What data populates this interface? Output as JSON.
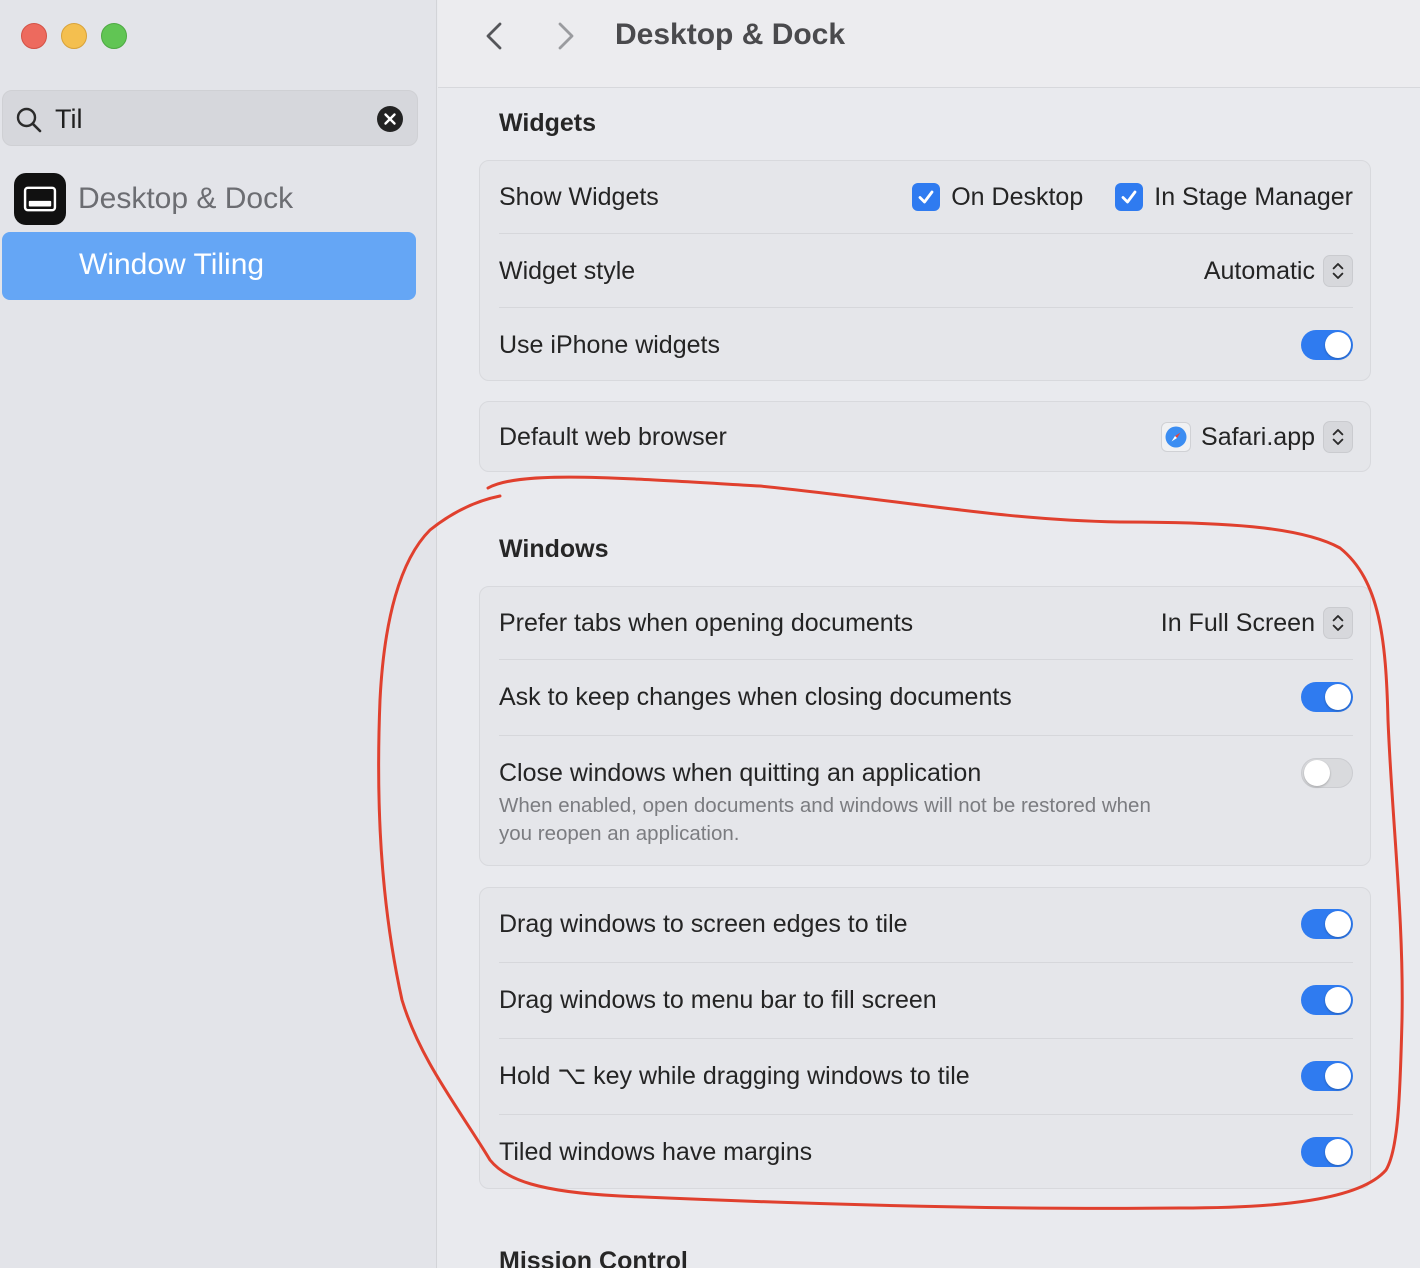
{
  "sidebar": {
    "search": {
      "value": "Til",
      "placeholder": "Search"
    },
    "app_label": "Desktop & Dock",
    "selected_item": "Window Tiling"
  },
  "toolbar": {
    "title": "Desktop & Dock"
  },
  "widgets": {
    "title": "Widgets",
    "show_widgets": {
      "label": "Show Widgets",
      "on_desktop": "On Desktop",
      "in_stage_manager": "In Stage Manager",
      "on_desktop_checked": true,
      "in_stage_manager_checked": true
    },
    "widget_style": {
      "label": "Widget style",
      "value": "Automatic"
    },
    "iphone_widgets": {
      "label": "Use iPhone widgets",
      "on": true
    }
  },
  "browser": {
    "label": "Default web browser",
    "value": "Safari.app"
  },
  "windows": {
    "title": "Windows",
    "prefer_tabs": {
      "label": "Prefer tabs when opening documents",
      "value": "In Full Screen"
    },
    "ask_keep_changes": {
      "label": "Ask to keep changes when closing documents",
      "on": true
    },
    "close_windows": {
      "label": "Close windows when quitting an application",
      "desc1": "When enabled, open documents and windows will not be restored when",
      "desc2": "you reopen an application.",
      "on": false
    },
    "tile_edges": {
      "label": "Drag windows to screen edges to tile",
      "on": true
    },
    "menu_bar_fill": {
      "label": "Drag windows to menu bar to fill screen",
      "on": true
    },
    "hold_option": {
      "label": "Hold ⌥ key while dragging windows to tile",
      "on": true
    },
    "tiled_margins": {
      "label": "Tiled windows have margins",
      "on": true
    }
  },
  "mission_control": {
    "title": "Mission Control"
  },
  "colors": {
    "accent": "#2f7bf0",
    "sidebar_selection": "#65a6f5",
    "annotation": "#e0402e"
  }
}
